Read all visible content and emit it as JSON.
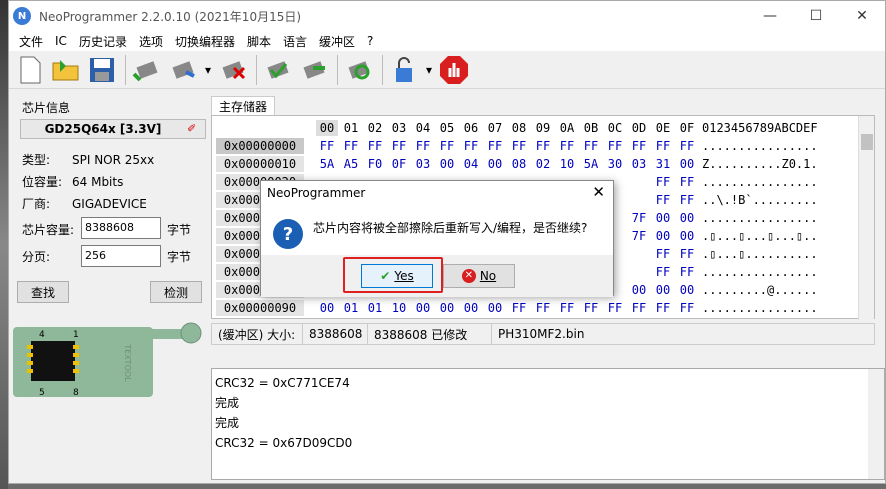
{
  "window": {
    "title": "NeoProgrammer 2.2.0.10 (2021年10月15日)",
    "min_icon": "minimize-icon",
    "max_icon": "maximize-icon",
    "close_icon": "close-icon"
  },
  "menu": [
    "文件",
    "IC",
    "历史记录",
    "选项",
    "切换编程器",
    "脚本",
    "语言",
    "缓冲区",
    "?"
  ],
  "chip_info": {
    "group_title": "芯片信息",
    "chip_name": "GD25Q64x [3.3V]",
    "type_label": "类型:",
    "type_value": "SPI NOR 25xx",
    "bits_label": "位容量:",
    "bits_value": "64 Mbits",
    "vendor_label": "厂商:",
    "vendor_value": "GIGADEVICE",
    "size_label": "芯片容量:",
    "size_value": "8388608",
    "size_unit": "字节",
    "page_label": "分页:",
    "page_value": "256",
    "page_unit": "字节",
    "find_button": "查找",
    "detect_button": "检测",
    "pin_labels": [
      "4",
      "1",
      "5",
      "8"
    ],
    "socket_text": "TEXTOOL"
  },
  "tab": {
    "label": "主存储器"
  },
  "hex": {
    "header_bytes": [
      "00",
      "01",
      "02",
      "03",
      "04",
      "05",
      "06",
      "07",
      "08",
      "09",
      "0A",
      "0B",
      "0C",
      "0D",
      "0E",
      "0F"
    ],
    "header_ascii": "0123456789ABCDEF",
    "rows": [
      {
        "addr": "0x00000000",
        "bytes": [
          "FF",
          "FF",
          "FF",
          "FF",
          "FF",
          "FF",
          "FF",
          "FF",
          "FF",
          "FF",
          "FF",
          "FF",
          "FF",
          "FF",
          "FF",
          "FF"
        ],
        "ascii": "................"
      },
      {
        "addr": "0x00000010",
        "bytes": [
          "5A",
          "A5",
          "F0",
          "0F",
          "03",
          "00",
          "04",
          "00",
          "08",
          "02",
          "10",
          "5A",
          "30",
          "03",
          "31",
          "00"
        ],
        "ascii": "Z..........Z0.1."
      },
      {
        "addr": "0x00000020",
        "bytes": [
          "",
          "",
          "",
          "",
          "",
          "",
          "",
          "",
          "",
          "",
          "",
          "",
          "",
          "",
          "FF",
          "FF"
        ],
        "ascii": "................"
      },
      {
        "addr": "0x00000030",
        "bytes": [
          "",
          "",
          "",
          "",
          "",
          "",
          "",
          "",
          "",
          "",
          "",
          "",
          "",
          "",
          "FF",
          "FF"
        ],
        "ascii": "..\\.!B`........."
      },
      {
        "addr": "0x00000040",
        "bytes": [
          "",
          "",
          "",
          "",
          "",
          "",
          "",
          "",
          "",
          "",
          "",
          "",
          "",
          "7F",
          "00",
          "00"
        ],
        "ascii": "................"
      },
      {
        "addr": "0x00000050",
        "bytes": [
          "",
          "",
          "",
          "",
          "",
          "",
          "",
          "",
          "",
          "",
          "",
          "",
          "",
          "7F",
          "00",
          "00"
        ],
        "ascii": ".▯...▯...▯...▯.."
      },
      {
        "addr": "0x00000060",
        "bytes": [
          "",
          "",
          "",
          "",
          "",
          "",
          "",
          "",
          "",
          "",
          "",
          "",
          "",
          "",
          "FF",
          "FF"
        ],
        "ascii": ".▯...▯.........."
      },
      {
        "addr": "0x00000070",
        "bytes": [
          "",
          "",
          "",
          "",
          "",
          "",
          "",
          "",
          "",
          "",
          "",
          "",
          "",
          "",
          "FF",
          "FF"
        ],
        "ascii": "................"
      },
      {
        "addr": "0x00000080",
        "bytes": [
          "",
          "",
          "",
          "",
          "",
          "",
          "",
          "",
          "",
          "",
          "",
          "",
          "",
          "00",
          "00",
          "00"
        ],
        "ascii": ".........@......"
      },
      {
        "addr": "0x00000090",
        "bytes": [
          "00",
          "01",
          "01",
          "10",
          "00",
          "00",
          "00",
          "00",
          "FF",
          "FF",
          "FF",
          "FF",
          "FF",
          "FF",
          "FF",
          "FF"
        ],
        "ascii": "................"
      }
    ]
  },
  "status": {
    "buffer_size": "(缓冲区) 大小:",
    "size_value": "8388608",
    "modified": "8388608 已修改",
    "filename": "PH310MF2.bin"
  },
  "log": [
    "CRC32 = 0xC771CE74",
    "完成",
    "完成",
    "CRC32 = 0x67D09CD0"
  ],
  "dialog": {
    "title": "NeoProgrammer",
    "message": "芯片内容将被全部擦除后重新写入/编程，是否继续?",
    "yes_label": "Yes",
    "no_label": "No",
    "accent_color": "#0078d7",
    "highlight_color": "#e02020"
  }
}
